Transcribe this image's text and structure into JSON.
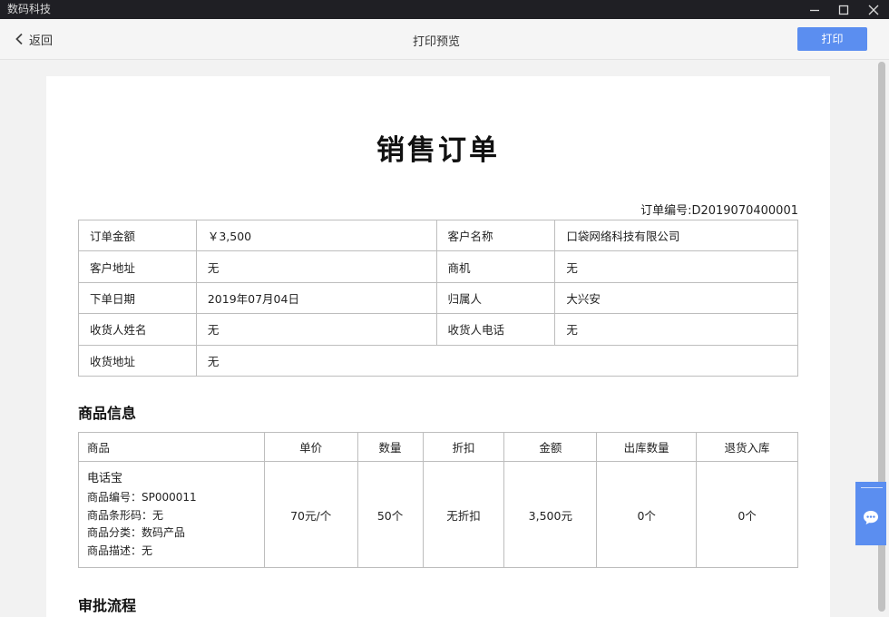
{
  "app": {
    "name": "数码科技"
  },
  "toolbar": {
    "back_label": "返回",
    "title": "打印预览",
    "print_label": "打印"
  },
  "doc": {
    "title": "销售订单",
    "order_no": "订单编号:D2019070400001",
    "info": [
      [
        {
          "label": "订单金额",
          "value": "￥3,500"
        },
        {
          "label": "客户名称",
          "value": "口袋网络科技有限公司"
        }
      ],
      [
        {
          "label": "客户地址",
          "value": "无"
        },
        {
          "label": "商机",
          "value": "无"
        }
      ],
      [
        {
          "label": "下单日期",
          "value": "2019年07月04日"
        },
        {
          "label": "归属人",
          "value": "大兴安"
        }
      ],
      [
        {
          "label": "收货人姓名",
          "value": "无"
        },
        {
          "label": "收货人电话",
          "value": "无"
        }
      ],
      [
        {
          "label": "收货地址",
          "value": "无"
        }
      ]
    ],
    "goods_section_title": "商品信息",
    "goods_headers": [
      "商品",
      "单价",
      "数量",
      "折扣",
      "金额",
      "出库数量",
      "退货入库"
    ],
    "goods_rows": [
      {
        "name": "电话宝",
        "details": [
          "商品编号：SP000011",
          "商品条形码：无",
          "商品分类：数码产品",
          "商品描述：无"
        ],
        "unit_price": "70元/个",
        "quantity": "50个",
        "discount": "无折扣",
        "amount": "3,500元",
        "out_qty": "0个",
        "return_qty": "0个"
      }
    ],
    "approval_section_title": "审批流程"
  },
  "icons": {
    "back": "chevron-left-icon",
    "chat": "chat-bubble-icon"
  },
  "colors": {
    "accent": "#5b8ef0",
    "titlebar": "#1f1f24"
  }
}
